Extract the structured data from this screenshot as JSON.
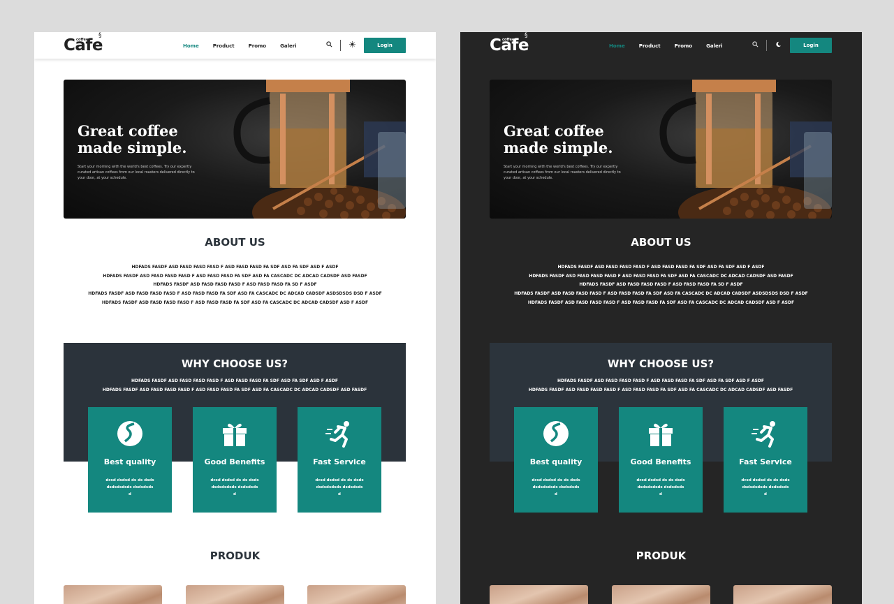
{
  "brand": {
    "small": "coffee",
    "name": "Cafe"
  },
  "nav": [
    "Home",
    "Product",
    "Promo",
    "Galeri"
  ],
  "login_label": "Login",
  "hero": {
    "title_line1": "Great coffee",
    "title_line2": "made simple.",
    "text": "Start your morning with the world's best coffees. Try our expertly curated artisan coffees from our local roasters delivered directly to your door, at your schedule."
  },
  "about": {
    "title": "ABOUT US",
    "lines": [
      "HDFADS FASDF ASD FASD FASD FASD F ASD FASD FASD FA SDF ASD FA SDF ASD F ASDF",
      "HDFADS FASDF ASD FASD FASD FASD F ASD FASD FASD FA SDF ASD FA CASCADC DC ADCAD CADSDF ASD FASDF",
      "HDFADS FASDF ASD FASD FASD FASD F ASD FASD FASD FA SD F ASDF",
      "HDFADS FASDF ASD FASD FASD FASD F ASD FASD FASD FA SDF ASD FA CASCADC DC ADCAD CADSDF ASDSDSDS DSD F ASDF",
      "HDFADS FASDF ASD FASD FASD FASD F ASD FASD FASD FA SDF ASD FA CASCADC DC ADCAD CADSDF ASD F ASDF"
    ]
  },
  "why": {
    "title": "WHY CHOOSE US?",
    "lines": [
      "HDFADS FASDF ASD FASD FASD FASD F ASD FASD FASD FA SDF ASD FA SDF ASD F ASDF",
      "HDFADS FASDF ASD FASD FASD FASD F ASD FASD FASD FA SDF ASD FA CASCADC DC ADCAD CADSDF ASD FASDF"
    ],
    "cards": [
      {
        "icon": "coffee-bean-icon",
        "title": "Best quality",
        "desc": "dcsd dsdsd ds ds dsdsdsdsdsdsds dsdsdsdsd"
      },
      {
        "icon": "gift-icon",
        "title": "Good Benefits",
        "desc": "dcsd dsdsd ds ds dsdsdsdsdsdsds dsdsdsdsd"
      },
      {
        "icon": "running-person-icon",
        "title": "Fast Service",
        "desc": "dcsd dsdsd ds ds dsdsdsdsdsdsds dsdsdsdsd"
      }
    ]
  },
  "produk_title": "PRODUK",
  "colors": {
    "accent": "#14877f",
    "dark_panel": "#252525",
    "why_bg": "#2b333b"
  }
}
